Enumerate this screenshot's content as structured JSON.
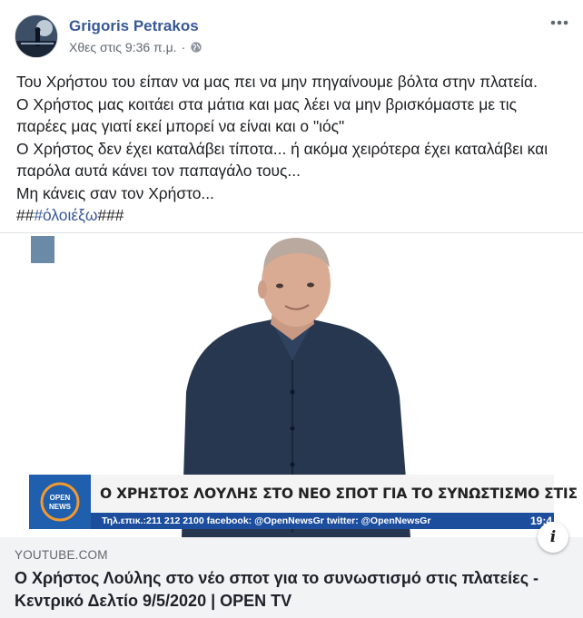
{
  "post": {
    "author": "Grigoris Petrakos",
    "timestamp": "Χθες στις 9:36 π.μ.",
    "separator": "·",
    "more_icon": "more-horizontal-icon",
    "privacy_icon": "globe-icon",
    "lines": [
      "Του Χρήστου του είπαν να μας πει να μην πηγαίνουμε βόλτα στην πλατεία.",
      "Ο Χρήστος μας κοιτάει στα μάτια και μας λέει να μην βρισκόμαστε με τις",
      "παρέες μας γιατί εκεί μπορεί να είναι και ο \"ιός\"",
      "Ο Χρήστος δεν έχει καταλάβει τίποτα... ή ακόμα χειρότερα έχει καταλάβει και",
      "παρόλα αυτά κάνει τον παπαγάλο τους...",
      "Μη κάνεις σαν τον Χρήστο..."
    ],
    "hashtag_prefix": "##",
    "hashtag": "#όλοιέξω",
    "hashtag_suffix": "###"
  },
  "link": {
    "domain": "YOUTUBE.COM",
    "title": "Ο Χρήστος Λούλης στο νέο σποτ για το συνωστισμό στις πλατείες - Κεντρικό Δελτίο 9/5/2020 | OPEN TV",
    "info_label": "i"
  },
  "video": {
    "logo_text": "OPEN NEWS",
    "headline": "Ο ΧΡΗΣΤΟΣ ΛΟΥΛΗΣ ΣΤΟ ΝΕΟ ΣΠΟΤ ΓΙΑ ΤΟ ΣΥΝΩΣΤΙΣΜΟ ΣΤΙΣ ΠΛΑΤΕΙΕΣ",
    "ticker": "Τηλ.επικ.:211 212 2100 facebook: @OpenNewsGr twitter: @OpenNewsGr",
    "time": "19:4",
    "colors": {
      "brand_blue": "#1d4e9e",
      "link_blue": "#385898"
    }
  }
}
